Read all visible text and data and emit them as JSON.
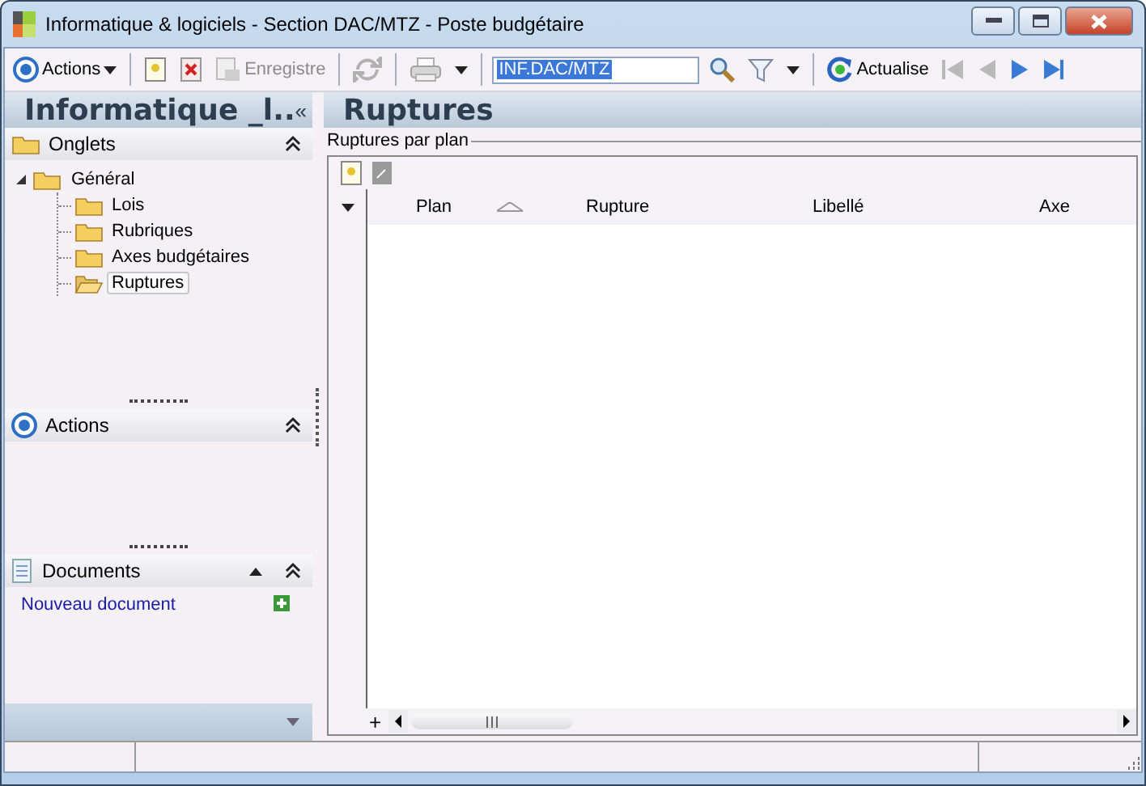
{
  "window": {
    "title": "Informatique & logiciels - Section DAC/MTZ -  Poste budgétaire"
  },
  "toolbar": {
    "items": [
      {
        "kind": "actions",
        "label": "Actions",
        "disabled": false
      },
      {
        "kind": "separator"
      },
      {
        "kind": "new",
        "disabled": false
      },
      {
        "kind": "delete",
        "disabled": false
      },
      {
        "kind": "save",
        "label": "Enregistre",
        "disabled": true
      },
      {
        "kind": "separator"
      },
      {
        "kind": "sync",
        "disabled": true
      },
      {
        "kind": "separator"
      },
      {
        "kind": "print",
        "disabled": true
      },
      {
        "kind": "dropdown",
        "disabled": false
      },
      {
        "kind": "separator"
      },
      {
        "kind": "search",
        "value": "INF.DAC/MTZ"
      },
      {
        "kind": "magnifier",
        "disabled": false
      },
      {
        "kind": "filter",
        "disabled": false
      },
      {
        "kind": "dropdown",
        "disabled": false
      },
      {
        "kind": "separator"
      },
      {
        "kind": "refresh",
        "label": "Actualise",
        "disabled": false
      },
      {
        "kind": "first",
        "disabled": true
      },
      {
        "kind": "prev",
        "disabled": true
      },
      {
        "kind": "next",
        "disabled": false
      },
      {
        "kind": "last",
        "disabled": false
      }
    ]
  },
  "sidebar": {
    "title": "Informatique _l..",
    "collapse": "«",
    "onglets": {
      "title": "Onglets",
      "tree": [
        {
          "label": "Général",
          "expanded": true,
          "selected": false,
          "children": [
            {
              "label": "Lois",
              "selected": false
            },
            {
              "label": "Rubriques",
              "selected": false
            },
            {
              "label": "Axes budgétaires",
              "selected": false
            },
            {
              "label": "Ruptures",
              "selected": true
            }
          ]
        }
      ]
    },
    "actions": {
      "title": "Actions"
    },
    "documents": {
      "title": "Documents",
      "link": "Nouveau document"
    }
  },
  "main": {
    "title": "Ruptures",
    "group": "Ruptures par plan",
    "grid": {
      "columns": [
        {
          "label": "Plan",
          "sorted": true
        },
        {
          "label": "Rupture",
          "sorted": false
        },
        {
          "label": "Libellé",
          "sorted": false
        },
        {
          "label": "Axe",
          "sorted": false
        }
      ],
      "add": "+"
    }
  }
}
